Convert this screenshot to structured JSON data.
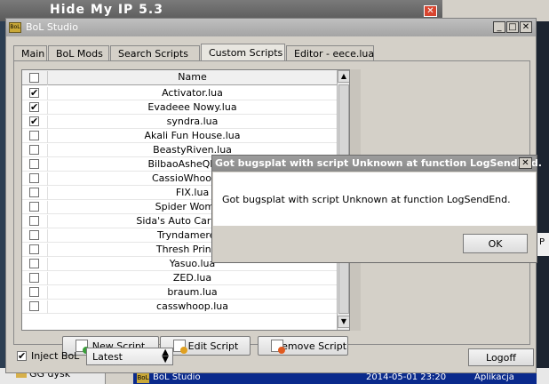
{
  "background": {
    "window_title": "Hide My IP 5.3",
    "close_glyph": "✕",
    "right_panel_fragment": "P",
    "explorer_item": "GG dysk",
    "task": {
      "logo": "BoL",
      "name": "BoL Studio",
      "date": "2014-05-01 23:20",
      "type": "Aplikacja"
    }
  },
  "window": {
    "logo": "BoL",
    "title": "BoL Studio",
    "buttons": {
      "minimize": "_",
      "maximize": "□",
      "close": "✕"
    }
  },
  "tabs": [
    {
      "label": "Main",
      "active": false
    },
    {
      "label": "BoL Mods",
      "active": false
    },
    {
      "label": "Search Scripts",
      "active": false
    },
    {
      "label": "Custom Scripts",
      "active": true
    },
    {
      "label": "Editor - eece.lua",
      "active": false
    }
  ],
  "script_list": {
    "header": "Name",
    "check_glyph": "✔",
    "scroll_up": "▲",
    "scroll_down": "▼",
    "rows": [
      {
        "name": "Activator.lua",
        "checked": true
      },
      {
        "name": "Evadeee Nowy.lua",
        "checked": true
      },
      {
        "name": "syndra.lua",
        "checked": true
      },
      {
        "name": "Akali Fun House.lua",
        "checked": false
      },
      {
        "name": "BeastyRiven.lua",
        "checked": false
      },
      {
        "name": "BilbaoAsheQExplo",
        "checked": false
      },
      {
        "name": "CassioWhooping",
        "checked": false
      },
      {
        "name": "FIX.lua",
        "checked": false
      },
      {
        "name": "Spider Woman.",
        "checked": false
      },
      {
        "name": "Sida's Auto Carry - Rev",
        "checked": false
      },
      {
        "name": "Tryndamere.lu",
        "checked": false
      },
      {
        "name": "Thresh Prince.l",
        "checked": false
      },
      {
        "name": "Yasuo.lua",
        "checked": false
      },
      {
        "name": "ZED.lua",
        "checked": false
      },
      {
        "name": "braum.lua",
        "checked": false
      },
      {
        "name": "casswhoop.lua",
        "checked": false
      }
    ]
  },
  "buttons": {
    "new_script": "New Script",
    "edit_script": "Edit Script",
    "remove_script": "Remove Script",
    "logoff": "Logoff"
  },
  "inject": {
    "label": "Inject BoL",
    "checked": true
  },
  "version_select": {
    "value": "Latest",
    "arrow_glyph": "▲▼"
  },
  "dialog": {
    "title": "Got bugsplat with script Unknown at function LogSendEnd.",
    "message": "Got bugsplat with script Unknown at function LogSendEnd.",
    "close_glyph": "✕",
    "ok_label": "OK"
  },
  "colors": {
    "new_icon": "#3aa03a",
    "edit_icon": "#e0a020",
    "remove_icon": "#e05a20"
  }
}
